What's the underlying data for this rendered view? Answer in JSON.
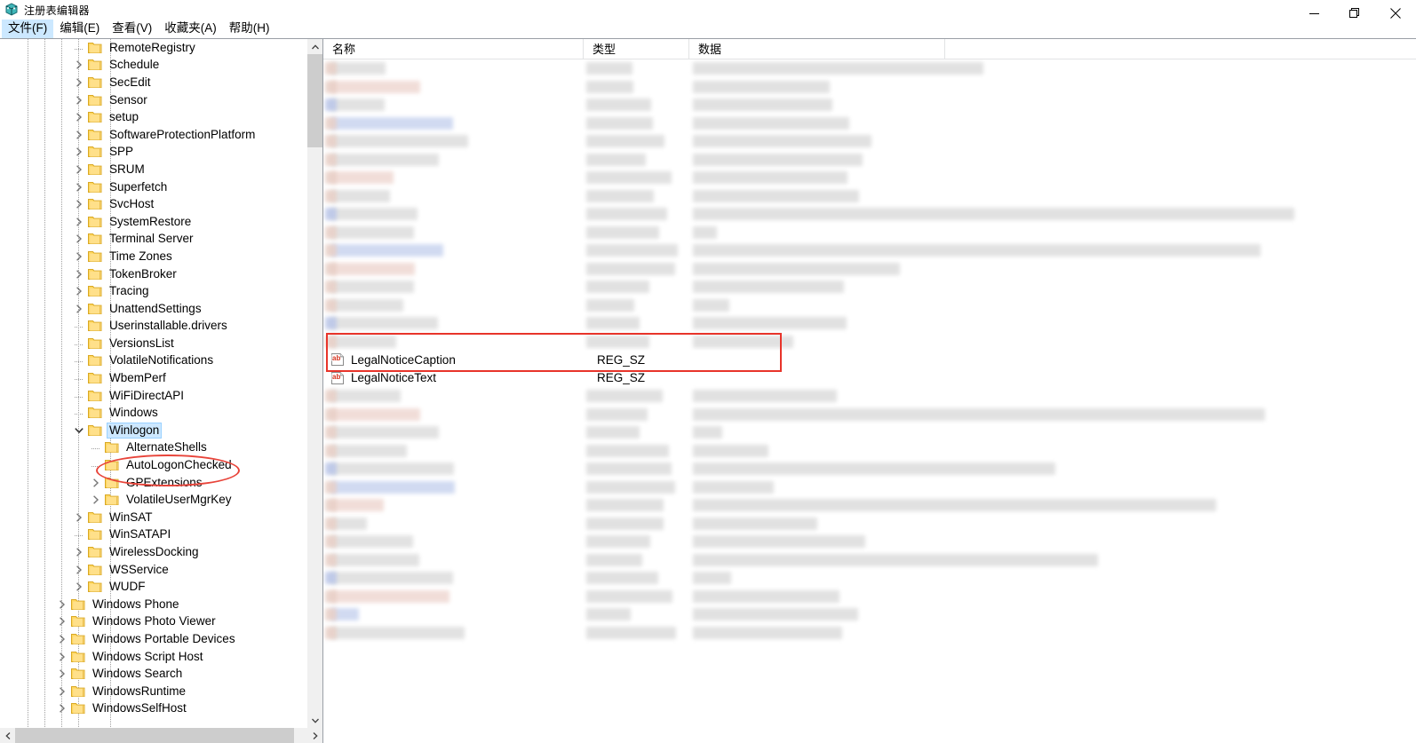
{
  "window": {
    "title": "注册表编辑器",
    "icon": "registry-editor-icon",
    "controls": {
      "minimize": "最小化",
      "restore": "还原",
      "close": "关闭"
    }
  },
  "menubar": {
    "items": [
      {
        "label": "文件(F)",
        "active": true
      },
      {
        "label": "编辑(E)",
        "active": false
      },
      {
        "label": "查看(V)",
        "active": false
      },
      {
        "label": "收藏夹(A)",
        "active": false
      },
      {
        "label": "帮助(H)",
        "active": false
      }
    ]
  },
  "tree": {
    "items": [
      {
        "label": "RemoteRegistry",
        "indent": 4,
        "expander": "none",
        "selected": false
      },
      {
        "label": "Schedule",
        "indent": 4,
        "expander": "collapsed",
        "selected": false
      },
      {
        "label": "SecEdit",
        "indent": 4,
        "expander": "collapsed",
        "selected": false
      },
      {
        "label": "Sensor",
        "indent": 4,
        "expander": "collapsed",
        "selected": false
      },
      {
        "label": "setup",
        "indent": 4,
        "expander": "collapsed",
        "selected": false
      },
      {
        "label": "SoftwareProtectionPlatform",
        "indent": 4,
        "expander": "collapsed",
        "selected": false
      },
      {
        "label": "SPP",
        "indent": 4,
        "expander": "collapsed",
        "selected": false
      },
      {
        "label": "SRUM",
        "indent": 4,
        "expander": "collapsed",
        "selected": false
      },
      {
        "label": "Superfetch",
        "indent": 4,
        "expander": "collapsed",
        "selected": false
      },
      {
        "label": "SvcHost",
        "indent": 4,
        "expander": "collapsed",
        "selected": false
      },
      {
        "label": "SystemRestore",
        "indent": 4,
        "expander": "collapsed",
        "selected": false
      },
      {
        "label": "Terminal Server",
        "indent": 4,
        "expander": "collapsed",
        "selected": false
      },
      {
        "label": "Time Zones",
        "indent": 4,
        "expander": "collapsed",
        "selected": false
      },
      {
        "label": "TokenBroker",
        "indent": 4,
        "expander": "collapsed",
        "selected": false
      },
      {
        "label": "Tracing",
        "indent": 4,
        "expander": "collapsed",
        "selected": false
      },
      {
        "label": "UnattendSettings",
        "indent": 4,
        "expander": "collapsed",
        "selected": false
      },
      {
        "label": "Userinstallable.drivers",
        "indent": 4,
        "expander": "none",
        "selected": false
      },
      {
        "label": "VersionsList",
        "indent": 4,
        "expander": "none",
        "selected": false
      },
      {
        "label": "VolatileNotifications",
        "indent": 4,
        "expander": "none",
        "selected": false
      },
      {
        "label": "WbemPerf",
        "indent": 4,
        "expander": "none",
        "selected": false
      },
      {
        "label": "WiFiDirectAPI",
        "indent": 4,
        "expander": "none",
        "selected": false
      },
      {
        "label": "Windows",
        "indent": 4,
        "expander": "none",
        "selected": false
      },
      {
        "label": "Winlogon",
        "indent": 4,
        "expander": "expanded",
        "selected": true
      },
      {
        "label": "AlternateShells",
        "indent": 5,
        "expander": "none",
        "selected": false
      },
      {
        "label": "AutoLogonChecked",
        "indent": 5,
        "expander": "none",
        "selected": false
      },
      {
        "label": "GPExtensions",
        "indent": 5,
        "expander": "collapsed",
        "selected": false
      },
      {
        "label": "VolatileUserMgrKey",
        "indent": 5,
        "expander": "collapsed",
        "selected": false
      },
      {
        "label": "WinSAT",
        "indent": 4,
        "expander": "collapsed",
        "selected": false
      },
      {
        "label": "WinSATAPI",
        "indent": 4,
        "expander": "none",
        "selected": false
      },
      {
        "label": "WirelessDocking",
        "indent": 4,
        "expander": "collapsed",
        "selected": false
      },
      {
        "label": "WSService",
        "indent": 4,
        "expander": "collapsed",
        "selected": false
      },
      {
        "label": "WUDF",
        "indent": 4,
        "expander": "collapsed",
        "selected": false
      },
      {
        "label": "Windows Phone",
        "indent": 3,
        "expander": "collapsed",
        "selected": false
      },
      {
        "label": "Windows Photo Viewer",
        "indent": 3,
        "expander": "collapsed",
        "selected": false
      },
      {
        "label": "Windows Portable Devices",
        "indent": 3,
        "expander": "collapsed",
        "selected": false
      },
      {
        "label": "Windows Script Host",
        "indent": 3,
        "expander": "collapsed",
        "selected": false
      },
      {
        "label": "Windows Search",
        "indent": 3,
        "expander": "collapsed",
        "selected": false
      },
      {
        "label": "WindowsRuntime",
        "indent": 3,
        "expander": "collapsed",
        "selected": false
      },
      {
        "label": "WindowsSelfHost",
        "indent": 3,
        "expander": "collapsed",
        "selected": false
      }
    ],
    "highlighted_key": "Winlogon"
  },
  "list": {
    "columns": [
      {
        "label": "名称",
        "key": "name"
      },
      {
        "label": "类型",
        "key": "type"
      },
      {
        "label": "数据",
        "key": "data"
      }
    ],
    "visible_values": [
      {
        "name": "LegalNoticeCaption",
        "type": "REG_SZ",
        "data": "",
        "icon": "string-value-icon"
      },
      {
        "name": "LegalNoticeText",
        "type": "REG_SZ",
        "data": "",
        "icon": "string-value-icon"
      }
    ],
    "redacted_rows_above": 16,
    "redacted_rows_below": 14
  },
  "annotations": [
    {
      "shape": "ellipse",
      "target": "Winlogon",
      "color": "#e8443a"
    },
    {
      "shape": "rectangle",
      "target": "LegalNotice values",
      "color": "#e8342a"
    }
  ],
  "colors": {
    "selection": "#cde8ff",
    "folder": "#ffd75e",
    "annotation_red": "#e8342a",
    "scrollbar_thumb": "#cdcdcd",
    "scrollbar_track": "#f0f0f0"
  }
}
